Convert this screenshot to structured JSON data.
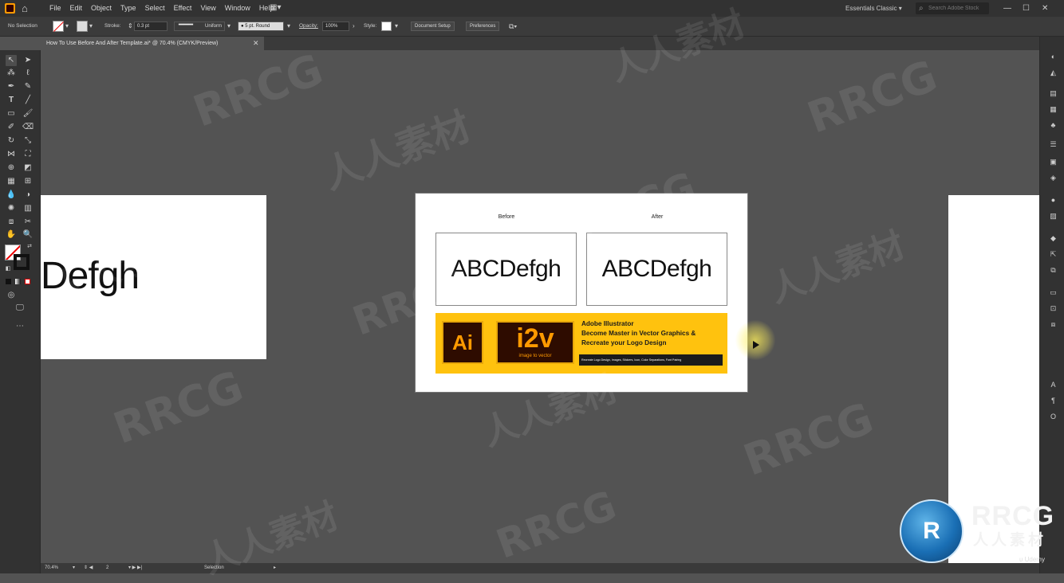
{
  "menubar": {
    "items": [
      "File",
      "Edit",
      "Object",
      "Type",
      "Select",
      "Effect",
      "View",
      "Window",
      "Help"
    ],
    "workspace": "Essentials Classic",
    "search_placeholder": "Search Adobe Stock",
    "minimize": "—",
    "maximize": "☐",
    "close": "✕"
  },
  "control_bar": {
    "selection_label": "No Selection",
    "stroke_label": "Stroke:",
    "stroke_weight": "0.3 pt",
    "stroke_profile": "Uniform",
    "brush": "5 pt. Round",
    "opacity_label": "Opacity:",
    "opacity_value": "100%",
    "style_label": "Style:",
    "document_setup": "Document Setup",
    "preferences": "Preferences"
  },
  "document_tab": {
    "title": "How To Use Before And After Template.ai* @ 70.4% (CMYK/Preview)",
    "close": "✕"
  },
  "status_bar": {
    "zoom": "70.4%",
    "artboard_num": "2",
    "tool_name": "Selection"
  },
  "canvas": {
    "left_artboard_text": "Defgh",
    "before_label": "Before",
    "after_label": "After",
    "before_sample": "ABCDefgh",
    "after_sample": "ABCDefgh",
    "banner": {
      "ai_badge": "Ai",
      "i2v_badge": "i2v",
      "i2v_sub": "image to vector",
      "title_line1": "Adobe Illustrator",
      "title_line2": "Become Master in Vector Graphics &",
      "title_line3": "Recreate your Logo Design",
      "strip_text": "Recreate Logo Design, Images, Stickers, Icon, Color Separations, Font Pairing",
      "bg_color": "#ffc20e",
      "badge_color": "#2e0c00",
      "accent_color": "#ff9a00"
    }
  },
  "watermark": {
    "latin": "RRCG",
    "cjk": "人人素材",
    "logo_letters": "R",
    "logo_text": "RRCG",
    "logo_cjk": "人人素材"
  },
  "overlay": {
    "udemy": "Udemy"
  },
  "colors": {
    "app_chrome": "#323232",
    "pasteboard": "#535353",
    "artboard": "#ffffff"
  }
}
